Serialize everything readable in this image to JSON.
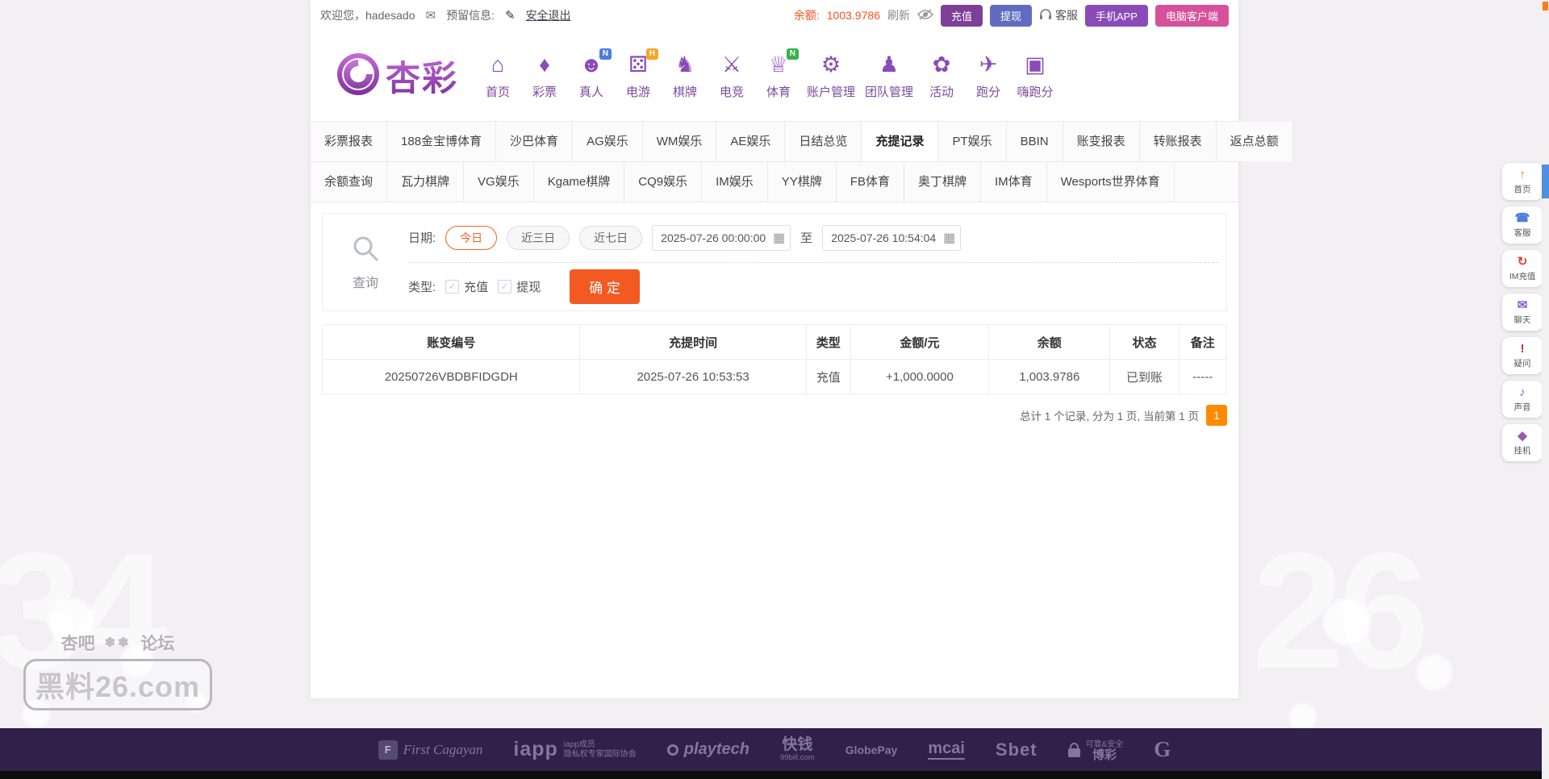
{
  "colors": {
    "primary_purple": "#8a3fa8",
    "accent_orange": "#f26522",
    "balance_orange": "#f4511e",
    "amount_red": "#e23b3b",
    "status_green": "#2eb150",
    "pagination_orange": "#ff8a00",
    "footer_bg": "#30204a"
  },
  "topbar": {
    "welcome": "欢迎您，hadesado",
    "mail_icon": "envelope-icon",
    "reserved_label": "预留信息:",
    "edit_icon": "pencil-icon",
    "logout": "安全退出",
    "balance_label": "余额:",
    "balance_value": "1003.9786",
    "refresh": "刷新",
    "eye_icon": "eye-hidden-icon",
    "recharge_btn": "充值",
    "withdraw_btn": "提现",
    "service_icon": "headset-icon",
    "service": "客服",
    "app_btn": "手机APP",
    "pc_btn": "电脑客户端"
  },
  "brand": {
    "logo_text": "杏彩",
    "logo_icon": "xingcai-flower-logo"
  },
  "nav": {
    "items": [
      {
        "label": "首页",
        "icon": "home-icon",
        "glyph": "⌂"
      },
      {
        "label": "彩票",
        "icon": "lottery-icon",
        "glyph": "♦"
      },
      {
        "label": "真人",
        "icon": "live-casino-icon",
        "glyph": "☻",
        "badge": "N"
      },
      {
        "label": "电游",
        "icon": "slots-games-icon",
        "glyph": "⚄",
        "badge": "H"
      },
      {
        "label": "棋牌",
        "icon": "board-games-icon",
        "glyph": "♞"
      },
      {
        "label": "电竞",
        "icon": "esports-icon",
        "glyph": "⚔"
      },
      {
        "label": "体育",
        "icon": "sports-icon",
        "glyph": "♕",
        "badge": "N"
      },
      {
        "label": "账户管理",
        "icon": "account-manage-icon",
        "glyph": "⚙"
      },
      {
        "label": "团队管理",
        "icon": "team-manage-icon",
        "glyph": "♟"
      },
      {
        "label": "活动",
        "icon": "promotions-icon",
        "glyph": "✿"
      },
      {
        "label": "跑分",
        "icon": "paofen-icon",
        "glyph": "✈"
      },
      {
        "label": "嗨跑分",
        "icon": "hi-paofen-icon",
        "glyph": "▣"
      }
    ]
  },
  "tabs": {
    "active": "充提记录",
    "row1": [
      "彩票报表",
      "188金宝博体育",
      "沙巴体育",
      "AG娱乐",
      "WM娱乐",
      "AE娱乐",
      "日结总览",
      "充提记录",
      "PT娱乐",
      "BBIN",
      "账变报表",
      "转账报表",
      "返点总额"
    ],
    "row2": [
      "余额查询",
      "瓦力棋牌",
      "VG娱乐",
      "Kgame棋牌",
      "CQ9娱乐",
      "IM娱乐",
      "YY棋牌",
      "FB体育",
      "奥丁棋牌",
      "IM体育",
      "Wesports世界体育"
    ]
  },
  "query": {
    "panel_label": "查询",
    "search_icon": "magnifier-icon",
    "date_label": "日期:",
    "quick_today": "今日",
    "quick_3d": "近三日",
    "quick_7d": "近七日",
    "active_quick": "今日",
    "date_from": "2025-07-26 00:00:00",
    "to_label": "至",
    "date_to": "2025-07-26 10:54:04",
    "calendar_icon": "calendar-icon",
    "type_label": "类型:",
    "type_recharge": "充值",
    "type_withdraw": "提现",
    "confirm": "确 定"
  },
  "table": {
    "headers": [
      "账变编号",
      "充提时间",
      "类型",
      "金额/元",
      "余额",
      "状态",
      "备注"
    ],
    "rows": [
      {
        "id": "20250726VBDBFIDGDH",
        "time": "2025-07-26 10:53:53",
        "type": "充值",
        "amount": "+1,000.0000",
        "balance": "1,003.9786",
        "status": "已到账",
        "remark": "-----"
      }
    ]
  },
  "pagination": {
    "summary": "总计 1 个记录, 分为 1 页, 当前第 1 页",
    "page": "1"
  },
  "sidebar": {
    "items": [
      {
        "label": "首页",
        "icon": "back-to-top-icon",
        "glyph": "↑"
      },
      {
        "label": "客服",
        "icon": "headset-icon",
        "glyph": "☎"
      },
      {
        "label": "IM充值",
        "icon": "im-recharge-icon",
        "glyph": "↻"
      },
      {
        "label": "聊天",
        "icon": "chat-icon",
        "glyph": "✉"
      },
      {
        "label": "疑问",
        "icon": "question-icon",
        "glyph": "!"
      },
      {
        "label": "声音",
        "icon": "sound-icon",
        "glyph": "♪"
      },
      {
        "label": "挂机",
        "icon": "idle-hangup-icon",
        "glyph": "◆"
      }
    ]
  },
  "footer": {
    "logos": [
      {
        "name": "first-cagayan",
        "main": "First Cagayan"
      },
      {
        "name": "iapp",
        "main": "iapp",
        "sub1": "iapp成员",
        "sub2": "隐私权专家国际协会"
      },
      {
        "name": "playtech",
        "main": "playtech"
      },
      {
        "name": "kuaiqian",
        "main": "快钱",
        "sub1": "99bill.com"
      },
      {
        "name": "globepay",
        "main": "GlobePay"
      },
      {
        "name": "mcai",
        "main": "mcai"
      },
      {
        "name": "sbet",
        "main": "Sbet"
      },
      {
        "name": "secure",
        "main": "博彩",
        "sub1": "可靠&安全"
      },
      {
        "name": "g-crest",
        "main": "G"
      }
    ]
  },
  "watermark": {
    "site_left": "杏吧",
    "site_right": "论坛",
    "domain": "黑料26.com"
  }
}
